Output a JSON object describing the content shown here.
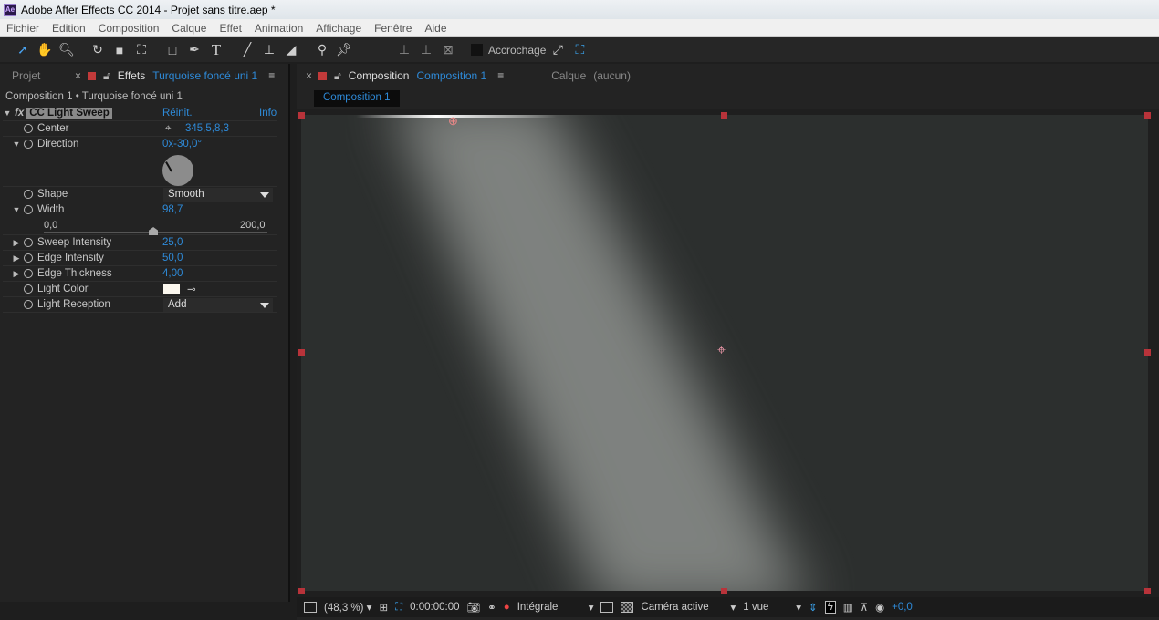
{
  "window": {
    "title": "Adobe After Effects CC 2014 - Projet sans titre.aep *",
    "logo": "Ae"
  },
  "menu": [
    "Fichier",
    "Edition",
    "Composition",
    "Calque",
    "Effet",
    "Animation",
    "Affichage",
    "Fenêtre",
    "Aide"
  ],
  "toolbar": {
    "snap_label": "Accrochage",
    "tools": [
      "selection-icon",
      "hand-icon",
      "zoom-icon",
      "rotate-icon",
      "camera-icon",
      "pan-behind-icon",
      "rectangle-icon",
      "pen-icon",
      "text-icon",
      "brush-icon",
      "clone-stamp-icon",
      "eraser-icon",
      "roto-brush-icon",
      "puppet-pin-icon",
      "axis-local-icon",
      "axis-world-icon",
      "axis-view-icon"
    ]
  },
  "left_panel": {
    "tab_project": "Projet",
    "tab_effects": "Effets",
    "effects_target": "Turquoise foncé uni 1",
    "breadcrumb": "Composition 1 • Turquoise foncé uni 1",
    "effect": {
      "name": "CC Light Sweep",
      "reset": "Réinit.",
      "info": "Info"
    },
    "props": {
      "center": {
        "label": "Center",
        "value": "345,5,8,3"
      },
      "direction": {
        "label": "Direction",
        "value": "0x-30,0°"
      },
      "shape": {
        "label": "Shape",
        "value": "Smooth"
      },
      "width": {
        "label": "Width",
        "value": "98,7",
        "min": "0,0",
        "max": "200,0",
        "fraction": 0.49
      },
      "sweep_intensity": {
        "label": "Sweep Intensity",
        "value": "25,0"
      },
      "edge_intensity": {
        "label": "Edge Intensity",
        "value": "50,0"
      },
      "edge_thickness": {
        "label": "Edge Thickness",
        "value": "4,00"
      },
      "light_color": {
        "label": "Light Color",
        "color": "#fbf7ee"
      },
      "light_reception": {
        "label": "Light Reception",
        "value": "Add"
      }
    }
  },
  "right_panel": {
    "tab_comp": "Composition",
    "comp_name": "Composition 1",
    "tab_layer": "Calque",
    "layer_value": "(aucun)",
    "comp_tab": "Composition 1",
    "bottom": {
      "zoom": "(48,3 %)",
      "timecode": "0:00:00:00",
      "resolution": "Intégrale",
      "camera": "Caméra active",
      "views": "1 vue",
      "exposure": "+0,0"
    }
  }
}
